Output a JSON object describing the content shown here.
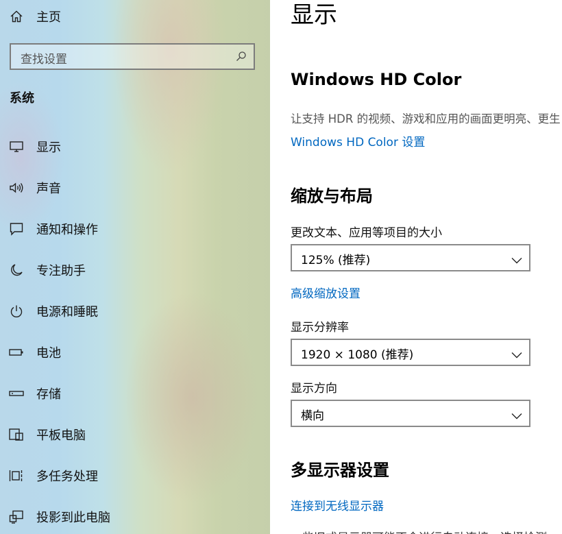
{
  "sidebar": {
    "home_label": "主页",
    "search_placeholder": "查找设置",
    "section_title": "系统",
    "items": [
      {
        "label": "显示",
        "icon": "monitor-icon"
      },
      {
        "label": "声音",
        "icon": "speaker-icon"
      },
      {
        "label": "通知和操作",
        "icon": "notification-icon"
      },
      {
        "label": "专注助手",
        "icon": "moon-icon"
      },
      {
        "label": "电源和睡眠",
        "icon": "power-icon"
      },
      {
        "label": "电池",
        "icon": "battery-icon"
      },
      {
        "label": "存储",
        "icon": "storage-icon"
      },
      {
        "label": "平板电脑",
        "icon": "tablet-icon"
      },
      {
        "label": "多任务处理",
        "icon": "multitask-icon"
      },
      {
        "label": "投影到此电脑",
        "icon": "project-icon"
      }
    ]
  },
  "main": {
    "title": "显示",
    "hdr": {
      "heading": "Windows HD Color",
      "description": "让支持 HDR 的视频、游戏和应用的画面更明亮、更生",
      "link": "Windows HD Color 设置"
    },
    "scale": {
      "heading": "缩放与布局",
      "text_size_label": "更改文本、应用等项目的大小",
      "text_size_value": "125% (推荐)",
      "advanced_link": "高级缩放设置",
      "resolution_label": "显示分辨率",
      "resolution_value": "1920 × 1080 (推荐)",
      "orientation_label": "显示方向",
      "orientation_value": "横向"
    },
    "multi": {
      "heading": "多显示器设置",
      "wireless_link": "连接到无线显示器",
      "partial_text": "一些旧式显示器可能不会进行自动连接，选择检测"
    }
  },
  "colors": {
    "accent_link": "#0067c0",
    "dropdown_border": "#8a8a8a"
  }
}
